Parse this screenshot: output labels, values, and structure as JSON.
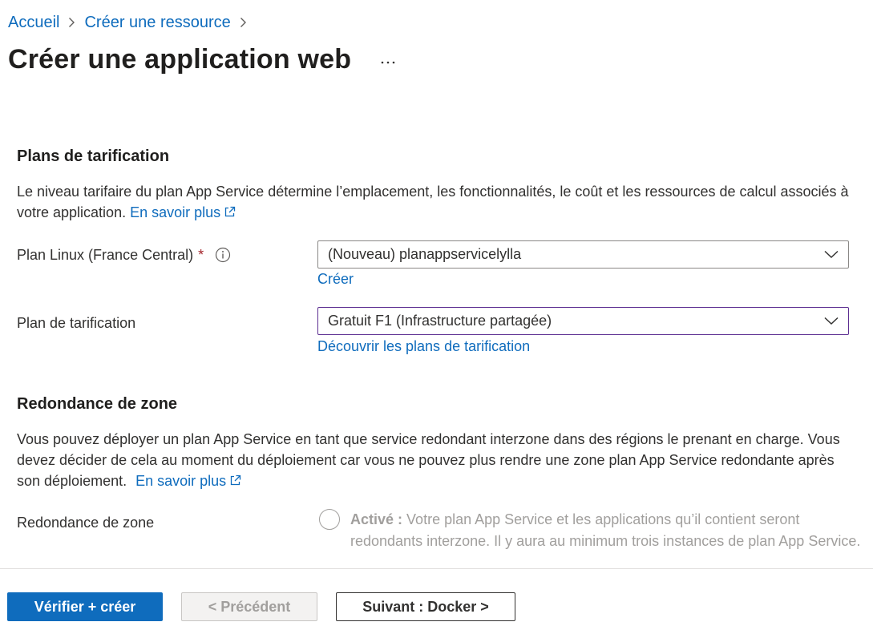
{
  "breadcrumb": {
    "items": [
      "Accueil",
      "Créer une ressource"
    ]
  },
  "page": {
    "title": "Créer une application web",
    "more_label": "···"
  },
  "pricing": {
    "title": "Plans de tarification",
    "description": "Le niveau tarifaire du plan App Service détermine l’emplacement, les fonctionnalités, le coût et les ressources de calcul associés à votre application.",
    "learn_more": "En savoir plus",
    "plan_label": "Plan Linux (France Central)",
    "required_mark": "*",
    "plan_value": "(Nouveau) planappservicelylla",
    "create_link": "Créer",
    "tier_label": "Plan de tarification",
    "tier_value": "Gratuit F1 (Infrastructure partagée)",
    "discover_link": "Découvrir les plans de tarification"
  },
  "zone": {
    "title": "Redondance de zone",
    "description": "Vous pouvez déployer un plan App Service en tant que service redondant interzone dans des régions le prenant en charge. Vous devez décider de cela au moment du déploiement car vous ne pouvez plus rendre une zone plan App Service redondante après son déploiement.",
    "learn_more": "En savoir plus",
    "field_label": "Redondance de zone",
    "option_bold": "Activé :",
    "option_text": "Votre plan App Service et les applications qu’il contient seront redondants interzone. Il y aura au minimum trois instances de plan App Service."
  },
  "footer": {
    "review_create": "Vérifier + créer",
    "previous": "< Précédent",
    "next": "Suivant : Docker >"
  },
  "colors": {
    "accent": "#0f6cbd",
    "required": "#a4262c",
    "focus_border": "#5c2e91"
  }
}
